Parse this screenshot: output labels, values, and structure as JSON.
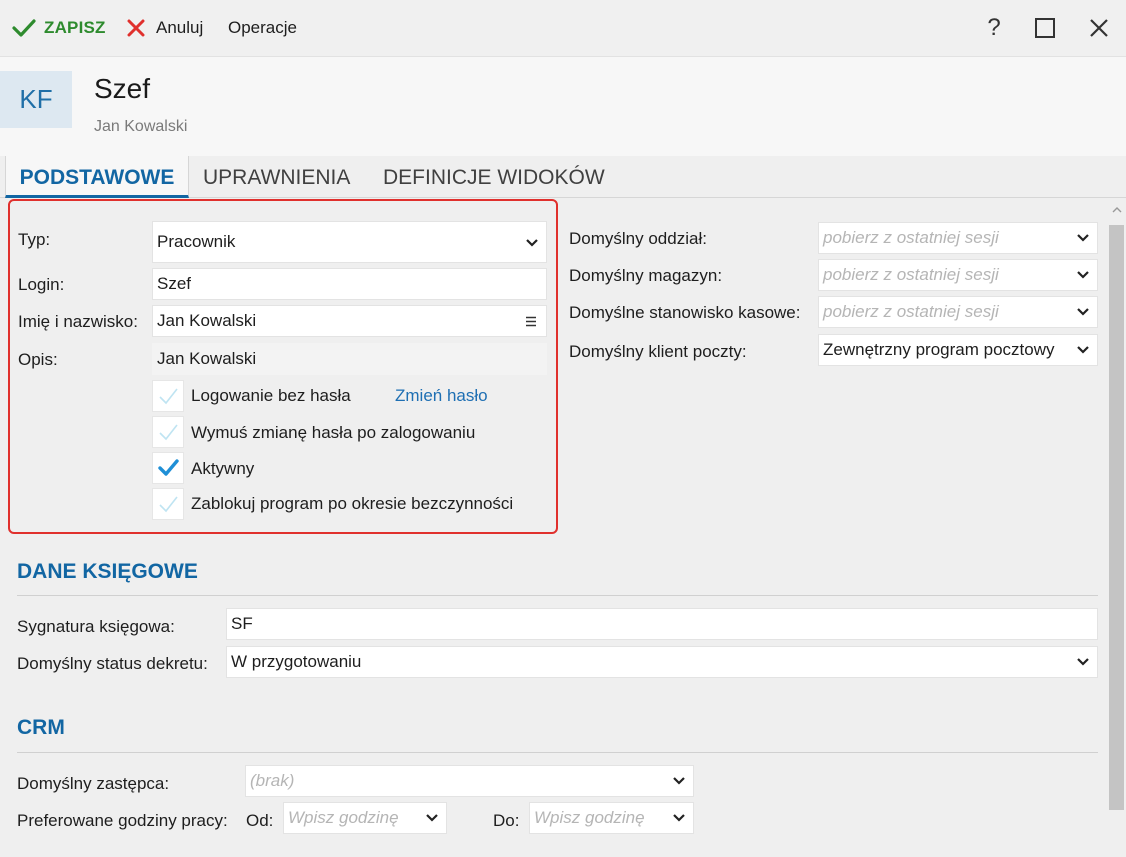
{
  "toolbar": {
    "save": "ZAPISZ",
    "cancel": "Anuluj",
    "operations": "Operacje",
    "help": "?"
  },
  "header": {
    "initials": "KF",
    "title": "Szef",
    "subtitle": "Jan Kowalski"
  },
  "tabs": [
    "PODSTAWOWE",
    "UPRAWNIENIA",
    "DEFINICJE WIDOKÓW"
  ],
  "basic": {
    "type_label": "Typ:",
    "type_value": "Pracownik",
    "login_label": "Login:",
    "login_value": "Szef",
    "name_label": "Imię i nazwisko:",
    "name_value": "Jan Kowalski",
    "desc_label": "Opis:",
    "desc_value": "Jan Kowalski",
    "checkboxes": [
      {
        "label": "Logowanie bez hasła",
        "checked": false
      },
      {
        "label": "Wymuś zmianę hasła po zalogowaniu",
        "checked": false
      },
      {
        "label": "Aktywny",
        "checked": true
      },
      {
        "label": "Zablokuj program po okresie bezczynności",
        "checked": false
      }
    ],
    "change_password": "Zmień hasło"
  },
  "defaults": {
    "branch_label": "Domyślny oddział:",
    "branch_placeholder": "pobierz z ostatniej sesji",
    "warehouse_label": "Domyślny magazyn:",
    "warehouse_placeholder": "pobierz z ostatniej sesji",
    "till_label": "Domyślne stanowisko kasowe:",
    "till_placeholder": "pobierz z ostatniej sesji",
    "mail_label": "Domyślny klient poczty:",
    "mail_value": "Zewnętrzny program pocztowy"
  },
  "accounting": {
    "title": "DANE KSIĘGOWE",
    "signature_label": "Sygnatura księgowa:",
    "signature_value": "SF",
    "status_label": "Domyślny status dekretu:",
    "status_value": "W przygotowaniu"
  },
  "crm": {
    "title": "CRM",
    "deputy_label": "Domyślny zastępca:",
    "deputy_placeholder": "(brak)",
    "hours_label": "Preferowane godziny pracy:",
    "from_label": "Od:",
    "from_placeholder": "Wpisz godzinę",
    "to_label": "Do:",
    "to_placeholder": "Wpisz godzinę"
  },
  "colors": {
    "accent": "#1266a3",
    "save_green": "#2e8b2e",
    "cancel_red": "#e0302d",
    "highlight_border": "#e0302d"
  }
}
